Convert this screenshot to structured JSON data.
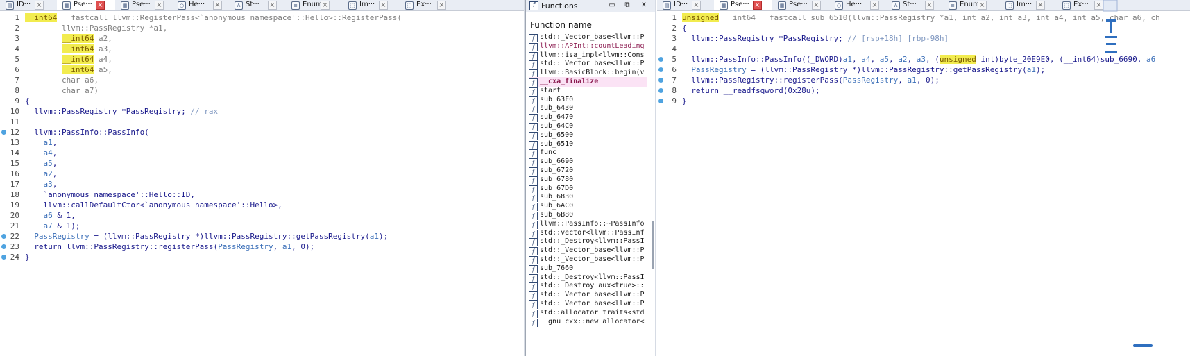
{
  "left": {
    "tabs": [
      {
        "icon": "ida-view-icon",
        "label": "ID···",
        "active": false
      },
      {
        "icon": "pseudocode-icon",
        "label": "Pse···",
        "active": true
      },
      {
        "icon": "pseudocode-icon",
        "label": "Pse···",
        "active": false
      },
      {
        "icon": "hex-view-icon",
        "label": "He···",
        "active": false
      },
      {
        "icon": "structures-icon",
        "label": "St···",
        "active": false
      },
      {
        "icon": "enums-icon",
        "label": "Enums",
        "active": false
      },
      {
        "icon": "imports-icon",
        "label": "Im···",
        "active": false
      },
      {
        "icon": "exports-icon",
        "label": "Ex···",
        "active": false
      }
    ],
    "lines": [
      {
        "n": "1",
        "dot": false,
        "segs": [
          [
            "hl",
            "__int64"
          ],
          [
            "gray",
            " __fastcall llvm::RegisterPass<`anonymous namespace'::Hello>::RegisterPass("
          ]
        ]
      },
      {
        "n": "2",
        "dot": false,
        "segs": [
          [
            "gray",
            "        llvm::PassRegistry *a1,"
          ]
        ]
      },
      {
        "n": "3",
        "dot": false,
        "segs": [
          [
            "gray",
            "        "
          ],
          [
            "hl",
            "__int64"
          ],
          [
            "gray",
            " a2,"
          ]
        ]
      },
      {
        "n": "4",
        "dot": false,
        "segs": [
          [
            "gray",
            "        "
          ],
          [
            "hl",
            "__int64"
          ],
          [
            "gray",
            " a3,"
          ]
        ]
      },
      {
        "n": "5",
        "dot": false,
        "segs": [
          [
            "gray",
            "        "
          ],
          [
            "hl",
            "__int64"
          ],
          [
            "gray",
            " a4,"
          ]
        ]
      },
      {
        "n": "6",
        "dot": false,
        "segs": [
          [
            "gray",
            "        "
          ],
          [
            "hl",
            "__int64"
          ],
          [
            "gray",
            " a5,"
          ]
        ]
      },
      {
        "n": "7",
        "dot": false,
        "segs": [
          [
            "gray",
            "        char a6,"
          ]
        ]
      },
      {
        "n": "8",
        "dot": false,
        "segs": [
          [
            "gray",
            "        char a7)"
          ]
        ]
      },
      {
        "n": "9",
        "dot": false,
        "segs": [
          [
            "plain",
            "{"
          ]
        ]
      },
      {
        "n": "10",
        "dot": false,
        "segs": [
          [
            "plain",
            "  llvm::PassRegistry *PassRegistry; "
          ],
          [
            "comment",
            "// rax"
          ]
        ]
      },
      {
        "n": "11",
        "dot": false,
        "segs": [
          [
            "plain",
            ""
          ]
        ]
      },
      {
        "n": "12",
        "dot": true,
        "segs": [
          [
            "plain",
            "  llvm::PassInfo::PassInfo("
          ]
        ]
      },
      {
        "n": "13",
        "dot": false,
        "segs": [
          [
            "plain",
            "    "
          ],
          [
            "var",
            "a1"
          ],
          [
            "plain",
            ","
          ]
        ]
      },
      {
        "n": "14",
        "dot": false,
        "segs": [
          [
            "plain",
            "    "
          ],
          [
            "var",
            "a4"
          ],
          [
            "plain",
            ","
          ]
        ]
      },
      {
        "n": "15",
        "dot": false,
        "segs": [
          [
            "plain",
            "    "
          ],
          [
            "var",
            "a5"
          ],
          [
            "plain",
            ","
          ]
        ]
      },
      {
        "n": "16",
        "dot": false,
        "segs": [
          [
            "plain",
            "    "
          ],
          [
            "var",
            "a2"
          ],
          [
            "plain",
            ","
          ]
        ]
      },
      {
        "n": "17",
        "dot": false,
        "segs": [
          [
            "plain",
            "    "
          ],
          [
            "var",
            "a3"
          ],
          [
            "plain",
            ","
          ]
        ]
      },
      {
        "n": "18",
        "dot": false,
        "segs": [
          [
            "plain",
            "    `anonymous namespace'::Hello::ID,"
          ]
        ]
      },
      {
        "n": "19",
        "dot": false,
        "segs": [
          [
            "plain",
            "    llvm::callDefaultCtor<`anonymous namespace'::Hello>,"
          ]
        ]
      },
      {
        "n": "20",
        "dot": false,
        "segs": [
          [
            "plain",
            "    "
          ],
          [
            "var",
            "a6"
          ],
          [
            "plain",
            " & 1,"
          ]
        ]
      },
      {
        "n": "21",
        "dot": false,
        "segs": [
          [
            "plain",
            "    "
          ],
          [
            "var",
            "a7"
          ],
          [
            "plain",
            " & 1);"
          ]
        ]
      },
      {
        "n": "22",
        "dot": true,
        "segs": [
          [
            "var",
            "  PassRegistry"
          ],
          [
            "plain",
            " = (llvm::PassRegistry *)llvm::PassRegistry::getPassRegistry("
          ],
          [
            "var",
            "a1"
          ],
          [
            "plain",
            ");"
          ]
        ]
      },
      {
        "n": "23",
        "dot": true,
        "segs": [
          [
            "plain",
            "  return llvm::PassRegistry::registerPass("
          ],
          [
            "var",
            "PassRegistry"
          ],
          [
            "plain",
            ", "
          ],
          [
            "var",
            "a1"
          ],
          [
            "plain",
            ", 0);"
          ]
        ]
      },
      {
        "n": "24",
        "dot": true,
        "segs": [
          [
            "plain",
            "}"
          ]
        ]
      }
    ]
  },
  "functions": {
    "title": "Functions",
    "column": "Function name",
    "items": [
      {
        "name": "std::_Vector_base<llvm::P",
        "style": ""
      },
      {
        "name": "llvm::APInt::countLeading",
        "style": "pinktxt"
      },
      {
        "name": "llvm::isa_impl<llvm::Cons",
        "style": ""
      },
      {
        "name": "std::_Vector_base<llvm::P",
        "style": ""
      },
      {
        "name": "llvm::BasicBlock::begin(v",
        "style": ""
      },
      {
        "name": "__cxa_finalize",
        "style": "pinkbold"
      },
      {
        "name": "start",
        "style": ""
      },
      {
        "name": "sub_63F0",
        "style": ""
      },
      {
        "name": "sub_6430",
        "style": ""
      },
      {
        "name": "sub_6470",
        "style": ""
      },
      {
        "name": "sub_64C0",
        "style": ""
      },
      {
        "name": "sub_6500",
        "style": ""
      },
      {
        "name": "sub_6510",
        "style": ""
      },
      {
        "name": "func",
        "style": ""
      },
      {
        "name": "sub_6690",
        "style": ""
      },
      {
        "name": "sub_6720",
        "style": ""
      },
      {
        "name": "sub_6780",
        "style": ""
      },
      {
        "name": "sub_67D0",
        "style": ""
      },
      {
        "name": "sub_6830",
        "style": ""
      },
      {
        "name": "sub_6AC0",
        "style": ""
      },
      {
        "name": "sub_6B80",
        "style": ""
      },
      {
        "name": "llvm::PassInfo::~PassInfo",
        "style": ""
      },
      {
        "name": "std::vector<llvm::PassInf",
        "style": ""
      },
      {
        "name": "std::_Destroy<llvm::PassI",
        "style": ""
      },
      {
        "name": "std::_Vector_base<llvm::P",
        "style": ""
      },
      {
        "name": "std::_Vector_base<llvm::P",
        "style": ""
      },
      {
        "name": "sub_7660",
        "style": ""
      },
      {
        "name": "std::_Destroy<llvm::PassI",
        "style": ""
      },
      {
        "name": "std::_Destroy_aux<true>::",
        "style": ""
      },
      {
        "name": "std::_Vector_base<llvm::P",
        "style": ""
      },
      {
        "name": "std::_Vector_base<llvm::P",
        "style": ""
      },
      {
        "name": "std::allocator_traits<std",
        "style": ""
      },
      {
        "name": "__gnu_cxx::new_allocator<",
        "style": ""
      }
    ]
  },
  "right": {
    "tabs": [
      {
        "icon": "ida-view-icon",
        "label": "ID···",
        "active": false
      },
      {
        "icon": "pseudocode-icon",
        "label": "Pse···",
        "active": true
      },
      {
        "icon": "pseudocode-icon",
        "label": "Pse···",
        "active": false
      },
      {
        "icon": "hex-view-icon",
        "label": "He···",
        "active": false
      },
      {
        "icon": "structures-icon",
        "label": "St···",
        "active": false
      },
      {
        "icon": "enums-icon",
        "label": "Enums",
        "active": false
      },
      {
        "icon": "imports-icon",
        "label": "Im···",
        "active": false
      },
      {
        "icon": "exports-icon",
        "label": "Ex···",
        "active": false
      }
    ],
    "lines": [
      {
        "n": "1",
        "dot": false,
        "segs": [
          [
            "hl",
            "unsigned"
          ],
          [
            "gray",
            " __int64 __fastcall sub_6510(llvm::PassRegistry *a1, int a2, int a3, int a4, int a5, char a6, ch"
          ]
        ]
      },
      {
        "n": "2",
        "dot": false,
        "segs": [
          [
            "plain",
            "{"
          ]
        ]
      },
      {
        "n": "3",
        "dot": false,
        "segs": [
          [
            "plain",
            "  llvm::PassRegistry *PassRegistry; "
          ],
          [
            "comment",
            "// [rsp+18h] [rbp-98h]"
          ]
        ]
      },
      {
        "n": "4",
        "dot": false,
        "segs": [
          [
            "plain",
            ""
          ]
        ]
      },
      {
        "n": "5",
        "dot": true,
        "segs": [
          [
            "plain",
            "  llvm::PassInfo::PassInfo((_DWORD)"
          ],
          [
            "var",
            "a1"
          ],
          [
            "plain",
            ", "
          ],
          [
            "var",
            "a4"
          ],
          [
            "plain",
            ", "
          ],
          [
            "var",
            "a5"
          ],
          [
            "plain",
            ", "
          ],
          [
            "var",
            "a2"
          ],
          [
            "plain",
            ", "
          ],
          [
            "var",
            "a3"
          ],
          [
            "plain",
            ", ("
          ],
          [
            "hl",
            "unsigned"
          ],
          [
            "plain",
            " int)byte_20E9E0, (__int64)sub_6690, "
          ],
          [
            "var",
            "a6"
          ]
        ]
      },
      {
        "n": "6",
        "dot": true,
        "segs": [
          [
            "var",
            "  PassRegistry"
          ],
          [
            "plain",
            " = (llvm::PassRegistry *)llvm::PassRegistry::getPassRegistry("
          ],
          [
            "var",
            "a1"
          ],
          [
            "plain",
            ");"
          ]
        ]
      },
      {
        "n": "7",
        "dot": true,
        "segs": [
          [
            "plain",
            "  llvm::PassRegistry::registerPass("
          ],
          [
            "var",
            "PassRegistry"
          ],
          [
            "plain",
            ", "
          ],
          [
            "var",
            "a1"
          ],
          [
            "plain",
            ", 0);"
          ]
        ]
      },
      {
        "n": "8",
        "dot": true,
        "segs": [
          [
            "plain",
            "  return __readfsqword(0x28u);"
          ]
        ]
      },
      {
        "n": "9",
        "dot": true,
        "segs": [
          [
            "plain",
            "}"
          ]
        ]
      }
    ]
  }
}
